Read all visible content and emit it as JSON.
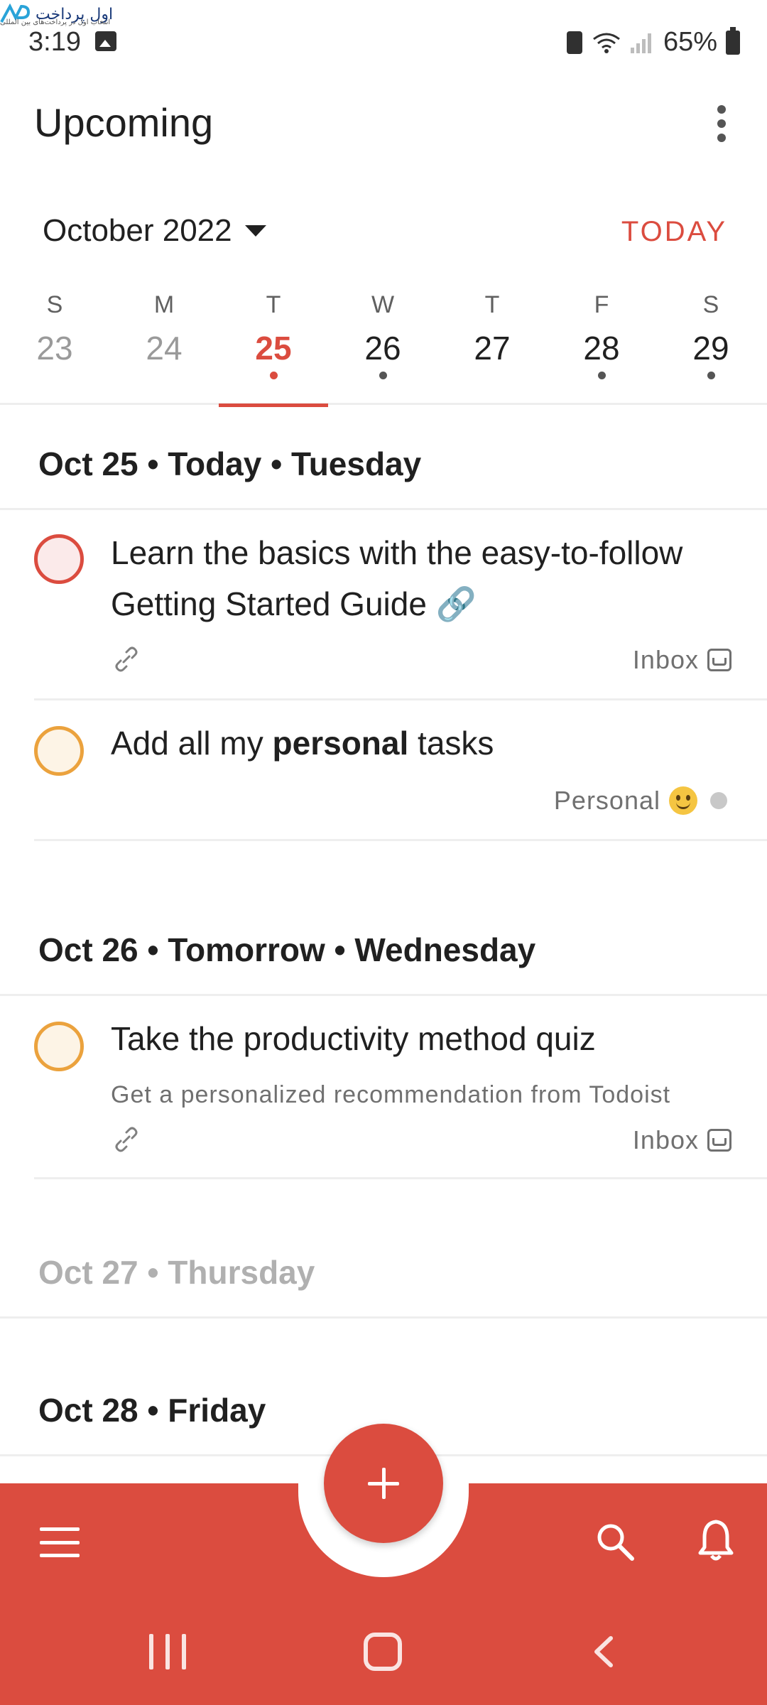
{
  "watermark": {
    "brand": "اول پرداخت",
    "tagline": "انتخاب اول در پرداخت‌های بین المللی"
  },
  "status_bar": {
    "time": "3:19",
    "battery_percent": "65%"
  },
  "header": {
    "title": "Upcoming"
  },
  "month_selector": {
    "label": "October 2022",
    "today_label": "TODAY"
  },
  "week": [
    {
      "dow": "S",
      "date": "23",
      "state": "past",
      "has_tasks": false
    },
    {
      "dow": "M",
      "date": "24",
      "state": "past",
      "has_tasks": false
    },
    {
      "dow": "T",
      "date": "25",
      "state": "selected",
      "has_tasks": true
    },
    {
      "dow": "W",
      "date": "26",
      "state": "future",
      "has_tasks": true
    },
    {
      "dow": "T",
      "date": "27",
      "state": "future",
      "has_tasks": false
    },
    {
      "dow": "F",
      "date": "28",
      "state": "future",
      "has_tasks": true
    },
    {
      "dow": "S",
      "date": "29",
      "state": "future",
      "has_tasks": true
    }
  ],
  "sections": [
    {
      "heading": "Oct 25 • Today • Tuesday"
    },
    {
      "heading": "Oct 26 • Tomorrow • Wednesday"
    },
    {
      "heading": "Oct 27 • Thursday"
    },
    {
      "heading": "Oct 28 • Friday"
    }
  ],
  "tasks": {
    "t1": {
      "title_line1": "Learn the basics with the easy-to-follow",
      "title_line2": "Getting Started Guide 🔗",
      "project": "Inbox",
      "priority_color": "#db4c3f"
    },
    "t2": {
      "title_pre": "Add all my ",
      "title_bold": "personal",
      "title_post": " tasks",
      "project": "Personal",
      "priority_color": "#eba23d"
    },
    "t3": {
      "title": "Take the productivity method quiz",
      "description": "Get a personalized recommendation from Todoist",
      "project": "Inbox",
      "priority_color": "#eba23d"
    }
  },
  "colors": {
    "accent": "#db4c3f",
    "orange": "#eba23d"
  },
  "icons": [
    "gallery-icon",
    "battery-saver-icon",
    "wifi-icon",
    "signal-icon",
    "battery-icon",
    "more-vertical-icon",
    "caret-down-icon",
    "link-icon",
    "inbox-icon",
    "smile-icon",
    "plus-icon",
    "menu-icon",
    "search-icon",
    "bell-icon",
    "recent-apps-icon",
    "home-icon",
    "back-icon"
  ]
}
